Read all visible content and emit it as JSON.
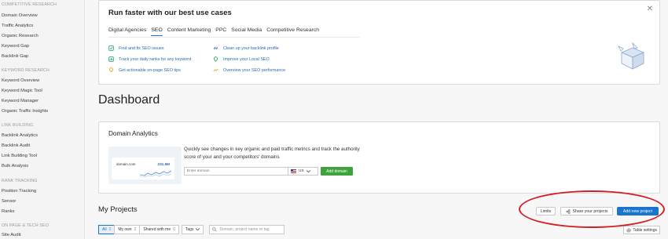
{
  "sidebar": {
    "sections": [
      {
        "title": "COMPETITIVE RESEARCH",
        "items": [
          "Domain Overview",
          "Traffic Analytics",
          "Organic Research",
          "Keyword Gap",
          "Backlink Gap"
        ]
      },
      {
        "title": "KEYWORD RESEARCH",
        "items": [
          "Keyword Overview",
          "Keyword Magic Tool",
          "Keyword Manager",
          "Organic Traffic Insights"
        ]
      },
      {
        "title": "LINK BUILDING",
        "items": [
          "Backlink Analytics",
          "Backlink Audit",
          "Link Building Tool",
          "Bulk Analysis"
        ]
      },
      {
        "title": "RANK TRACKING",
        "items": [
          "Position Tracking",
          "Sensor",
          "Ranks"
        ]
      },
      {
        "title": "ON PAGE & TECH SEO",
        "items": [
          "Site Audit"
        ]
      }
    ]
  },
  "usecases": {
    "title": "Run faster with our best use cases",
    "close": "✕",
    "tabs": [
      "Digital Agencies",
      "SEO",
      "Content Marketing",
      "PPC",
      "Social Media",
      "Competitive Research"
    ],
    "active_tab": "SEO",
    "links_left": [
      "Find and fix SEO issues",
      "Track your daily ranks for any keyword",
      "Get actionable on-page SEO tips"
    ],
    "links_right": [
      "Clean up your backlink profile",
      "Improve your Local SEO",
      "Overview your SEO performance"
    ]
  },
  "dashboard": {
    "title": "Dashboard"
  },
  "domain_analytics": {
    "title": "Domain Analytics",
    "preview_domain": "domain.com",
    "preview_metric": "231.5M",
    "description": "Quickly see changes in key organic and paid traffic metrics and track the authority score of your and your competitors' domains",
    "input_placeholder": "Enter domain",
    "country": "US",
    "button": "Add domain"
  },
  "projects": {
    "title": "My Projects",
    "limits": "Limits",
    "share": "Share your projects",
    "add": "Add new project",
    "filters": [
      {
        "label": "All",
        "count": "2"
      },
      {
        "label": "My own",
        "count": "2"
      },
      {
        "label": "Shared with me",
        "count": "0"
      },
      {
        "label": "Tags",
        "count": ""
      }
    ],
    "search_placeholder": "Domain, project name or tag",
    "table_settings": "Table settings"
  },
  "colors": {
    "primary": "#1874cd",
    "success": "#3fa33d",
    "highlight": "#d21f26"
  }
}
